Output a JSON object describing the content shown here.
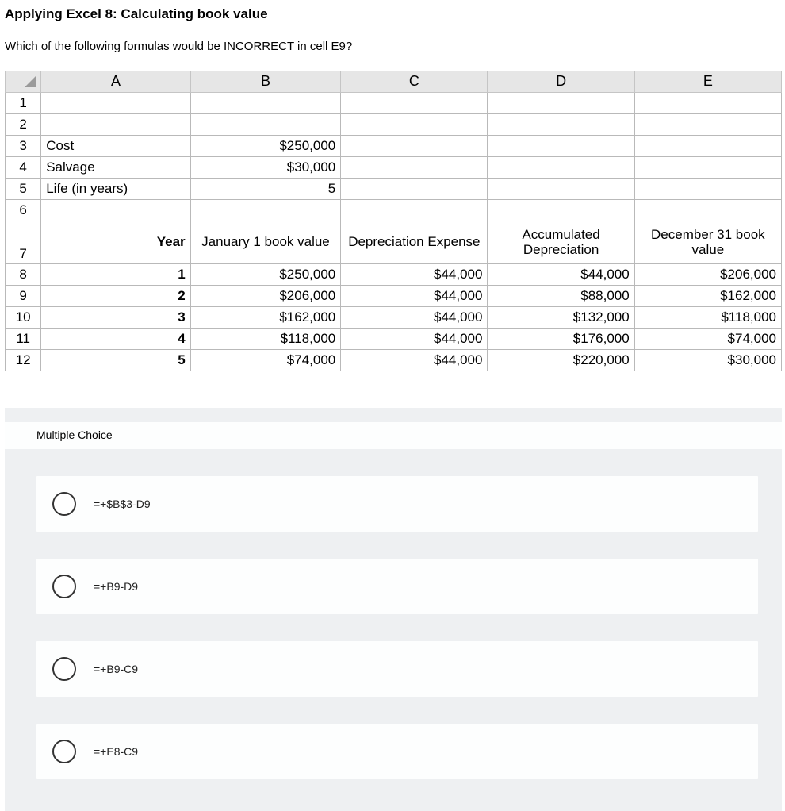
{
  "title": "Applying Excel 8: Calculating book value",
  "question": "Which of the following formulas would be INCORRECT in cell E9?",
  "columns": [
    "A",
    "B",
    "C",
    "D",
    "E"
  ],
  "rows": [
    "1",
    "2",
    "3",
    "4",
    "5",
    "6",
    "7",
    "8",
    "9",
    "10",
    "11",
    "12"
  ],
  "inputs": {
    "cost_label": "Cost",
    "cost_value": "$250,000",
    "salvage_label": "Salvage",
    "salvage_value": "$30,000",
    "life_label": "Life (in years)",
    "life_value": "5"
  },
  "headers": {
    "year": "Year",
    "jan1": "January 1 book value",
    "dep": "Depreciation Expense",
    "acc": "Accumulated Depreciation",
    "dec31": "December 31 book value"
  },
  "table": [
    {
      "year": "1",
      "jan1": "$250,000",
      "dep": "$44,000",
      "acc": "$44,000",
      "dec31": "$206,000"
    },
    {
      "year": "2",
      "jan1": "$206,000",
      "dep": "$44,000",
      "acc": "$88,000",
      "dec31": "$162,000"
    },
    {
      "year": "3",
      "jan1": "$162,000",
      "dep": "$44,000",
      "acc": "$132,000",
      "dec31": "$118,000"
    },
    {
      "year": "4",
      "jan1": "$118,000",
      "dep": "$44,000",
      "acc": "$176,000",
      "dec31": "$74,000"
    },
    {
      "year": "5",
      "jan1": "$74,000",
      "dep": "$44,000",
      "acc": "$220,000",
      "dec31": "$30,000"
    }
  ],
  "mc_title": "Multiple Choice",
  "choices": [
    "=+$B$3-D9",
    "=+B9-D9",
    "=+B9-C9",
    "=+E8-C9"
  ]
}
